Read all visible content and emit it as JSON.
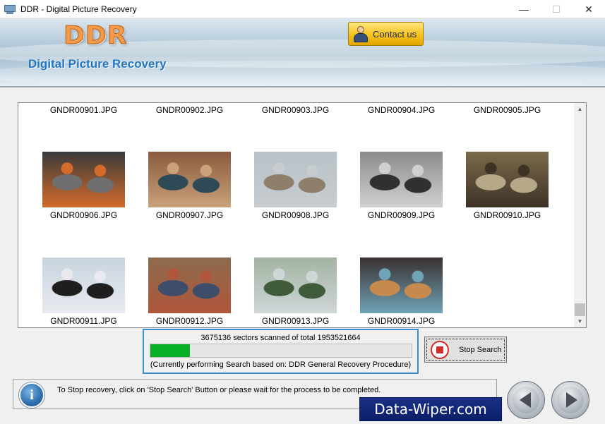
{
  "window": {
    "title": "DDR - Digital Picture Recovery",
    "controls": [
      "minimize",
      "maximize",
      "close"
    ]
  },
  "header": {
    "logo": "DDR",
    "subtitle": "Digital Picture Recovery",
    "contact_label": "Contact us"
  },
  "gallery": {
    "files": [
      {
        "name": "GNDR00901.JPG",
        "thumb_colors": []
      },
      {
        "name": "GNDR00902.JPG",
        "thumb_colors": []
      },
      {
        "name": "GNDR00903.JPG",
        "thumb_colors": []
      },
      {
        "name": "GNDR00904.JPG",
        "thumb_colors": []
      },
      {
        "name": "GNDR00905.JPG",
        "thumb_colors": []
      },
      {
        "name": "GNDR00906.JPG",
        "thumb_colors": [
          "#3a3a3a",
          "#6f6f6f",
          "#d36b2b"
        ]
      },
      {
        "name": "GNDR00907.JPG",
        "thumb_colors": [
          "#8a5a3e",
          "#2f4a57",
          "#c9a27a"
        ]
      },
      {
        "name": "GNDR00908.JPG",
        "thumb_colors": [
          "#b8c2c8",
          "#8e7f6a",
          "#c7ccd0"
        ]
      },
      {
        "name": "GNDR00909.JPG",
        "thumb_colors": [
          "#8c8c8c",
          "#303030",
          "#d0d0d0"
        ]
      },
      {
        "name": "GNDR00910.JPG",
        "thumb_colors": [
          "#7a6a4a",
          "#b5a98a",
          "#3d3226"
        ]
      },
      {
        "name": "GNDR00911.JPG",
        "thumb_colors": [
          "#c9d4de",
          "#1e1e1e",
          "#e7ebef"
        ]
      },
      {
        "name": "GNDR00912.JPG",
        "thumb_colors": [
          "#8d6b4e",
          "#3d4d6a",
          "#b0563a"
        ]
      },
      {
        "name": "GNDR00913.JPG",
        "thumb_colors": [
          "#a3b4a2",
          "#3f5b3a",
          "#cfd6d8"
        ]
      },
      {
        "name": "GNDR00914.JPG",
        "thumb_colors": [
          "#3a3030",
          "#c78a4e",
          "#6fa3b8"
        ]
      }
    ]
  },
  "progress": {
    "sectors_text": "3675136 sectors scanned of total 1953521664",
    "fraction": 0.15,
    "procedure_text": "(Currently performing Search based on:  DDR General Recovery Procedure)"
  },
  "stop_search_label": "Stop Search",
  "status": {
    "message": "To Stop recovery, click on 'Stop Search' Button or please wait for the process to be completed."
  },
  "brand": "Data-Wiper.com",
  "colors": {
    "progress_fill": "#06b025",
    "progress_border": "#3a8fd1",
    "subtitle": "#2177c0",
    "brand_bg": "#1a2f86"
  }
}
